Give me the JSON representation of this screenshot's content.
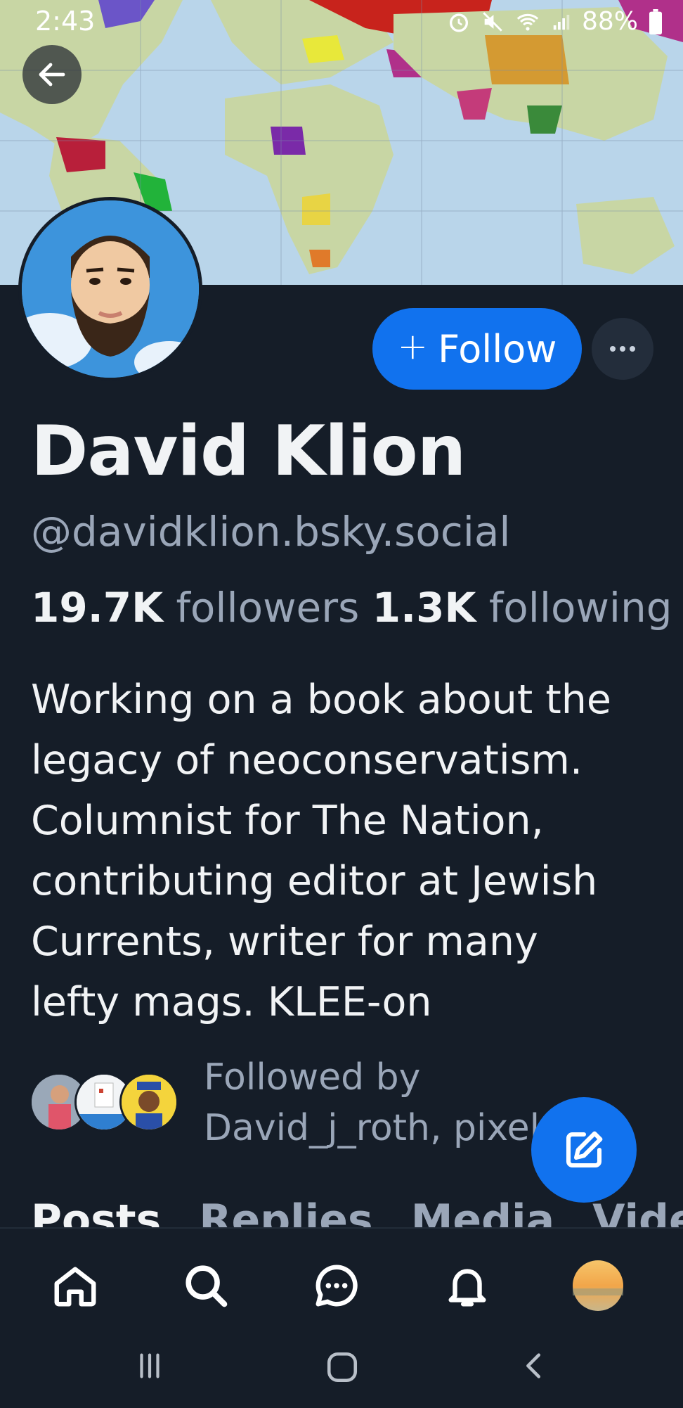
{
  "status_bar": {
    "time": "2:43",
    "battery": "88%"
  },
  "profile": {
    "display_name": "David Klion",
    "handle": "@davidklion.bsky.social",
    "followers_count": "19.7K",
    "followers_label": "followers",
    "following_count": "1.3K",
    "following_label": "following",
    "bio": "Working on a book about the\nlegacy of neoconservatism.\nColumnist for The Nation,\ncontributing editor at Jewish\nCurrents, writer for many\nlefty mags. KLEE-on",
    "followed_by_label": "Followed by",
    "followed_by_names": "David_j_roth, pixel…"
  },
  "actions": {
    "follow_plus": "+",
    "follow_label": "Follow",
    "more_icon": "ellipsis-icon"
  },
  "tabs": [
    {
      "label": "Posts",
      "active": true
    },
    {
      "label": "Replies",
      "active": false
    },
    {
      "label": "Media",
      "active": false
    },
    {
      "label": "Videos",
      "active": false
    }
  ],
  "bottom_nav": [
    "home-icon",
    "search-icon",
    "chat-icon",
    "bell-icon",
    "profile-avatar"
  ],
  "system_nav": [
    "recents-icon",
    "home-circle-icon",
    "back-chevron-icon"
  ],
  "colors": {
    "background": "#151d28",
    "accent": "#1172ee",
    "muted_text": "#9aa6b8"
  }
}
